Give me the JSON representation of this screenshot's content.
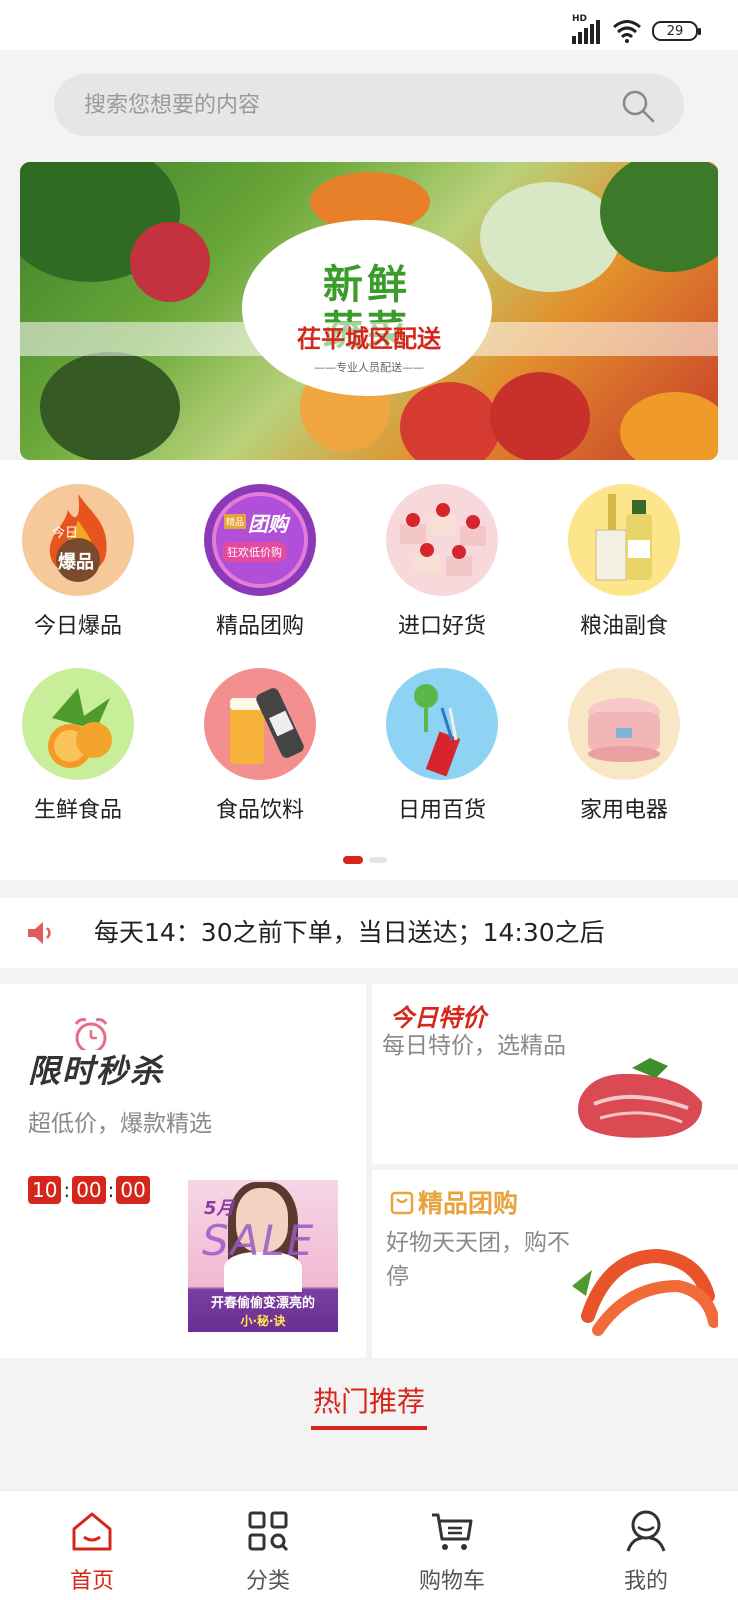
{
  "status_bar": {
    "network": "HD",
    "battery": "29"
  },
  "search": {
    "placeholder": "搜索您想要的内容"
  },
  "banner": {
    "line1": "新鲜",
    "line2": "蔬菜",
    "line3": "茌平城区配送",
    "line4": "——专业人员配送——"
  },
  "categories": [
    {
      "label": "今日爆品",
      "icon": "flame-icon",
      "badge": "爆品",
      "badge_small": "今日"
    },
    {
      "label": "精品团购",
      "icon": "group-buy-icon",
      "badge": "团购",
      "badge_small": "狂欢低价购",
      "tag": "精品"
    },
    {
      "label": "进口好货",
      "icon": "cake-icon"
    },
    {
      "label": "粮油副食",
      "icon": "oil-bottle-icon"
    },
    {
      "label": "生鲜食品",
      "icon": "orange-icon"
    },
    {
      "label": "食品饮料",
      "icon": "beer-icon"
    },
    {
      "label": "日用百货",
      "icon": "pin-icon"
    },
    {
      "label": "家用电器",
      "icon": "rice-cooker-icon"
    }
  ],
  "notice": {
    "text": "每天14：30之前下单，当日送达；14:30之后"
  },
  "seckill": {
    "title": "限时秒杀",
    "subtitle": "超低价，爆款精选",
    "countdown": [
      "10",
      "00",
      "00"
    ],
    "image": {
      "month": "5月",
      "word": "SALE",
      "line1": "开春偷偷变漂亮的",
      "line2": "小·秘·诀"
    }
  },
  "daily_deal": {
    "title": "今日特价",
    "subtitle": "每日特价，选精品"
  },
  "group_buy": {
    "title": "精品团购",
    "subtitle": "好物天天团，购不停"
  },
  "hot": {
    "title": "热门推荐"
  },
  "tabs": [
    {
      "label": "首页",
      "icon": "home-icon",
      "active": true
    },
    {
      "label": "分类",
      "icon": "category-icon",
      "active": false
    },
    {
      "label": "购物车",
      "icon": "cart-icon",
      "active": false
    },
    {
      "label": "我的",
      "icon": "profile-icon",
      "active": false
    }
  ],
  "colors": {
    "accent": "#d6251b",
    "gold": "#e8a33a",
    "background": "#f3f3f3"
  }
}
